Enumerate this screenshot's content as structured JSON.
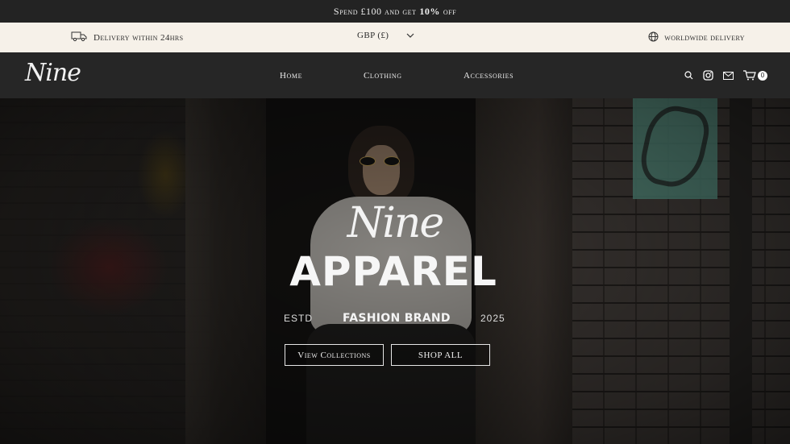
{
  "announcement": {
    "prefix": "Spend £100 and get",
    "bold": "10%",
    "suffix": "off"
  },
  "infobar": {
    "delivery_label": "Delivery within 24hrs",
    "delivery_icon": "truck-icon",
    "currency": "GBP (£)",
    "currency_icon": "chevron-down-icon",
    "worldwide_label": "worldwide delivery",
    "worldwide_icon": "globe-icon"
  },
  "header": {
    "logo_text": "Nine",
    "nav": {
      "home": "Home",
      "clothing": "Clothing",
      "accessories": "Accessories"
    },
    "icons": [
      "search-icon",
      "instagram-icon",
      "mail-icon",
      "cart-icon"
    ],
    "cart_count": "0"
  },
  "hero": {
    "script": "Nine",
    "title": "APPAREL",
    "estd": "ESTD",
    "brand": "FASHION BRAND",
    "year": "2025",
    "btn_view": "View Collections",
    "btn_shop": "SHOP ALL"
  },
  "colors": {
    "bar_dark": "#232323",
    "infobar_bg": "#f6f1e9",
    "header_bg": "#262626"
  }
}
